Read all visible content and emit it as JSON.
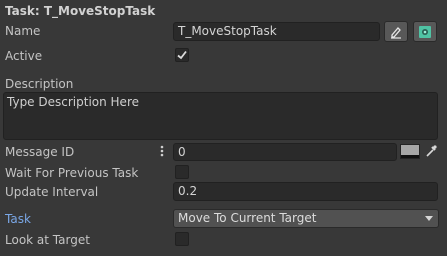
{
  "header": {
    "title": "Task: T_MoveStopTask"
  },
  "name": {
    "label": "Name",
    "value": "T_MoveStopTask"
  },
  "active": {
    "label": "Active",
    "checked": true
  },
  "description": {
    "label": "Description",
    "placeholder": "Type Description Here"
  },
  "message_id": {
    "label": "Message ID",
    "value": "0"
  },
  "wait_for_previous": {
    "label": "Wait For Previous Task",
    "checked": false
  },
  "update_interval": {
    "label": "Update Interval",
    "value": "0.2"
  },
  "task": {
    "label": "Task",
    "selected": "Move To Current Target"
  },
  "look_at_target": {
    "label": "Look at Target",
    "checked": false
  },
  "icons": [
    "edit-icon",
    "ping-object-icon",
    "more-vertical-icon",
    "color-swatch",
    "eyedropper-icon",
    "checkmark-icon",
    "dropdown-arrow-icon"
  ],
  "colors": {
    "background": "#383838",
    "field": "#2a2a2a",
    "accent_label": "#7aa7e6",
    "ping_icon": "#4fc3a4"
  }
}
